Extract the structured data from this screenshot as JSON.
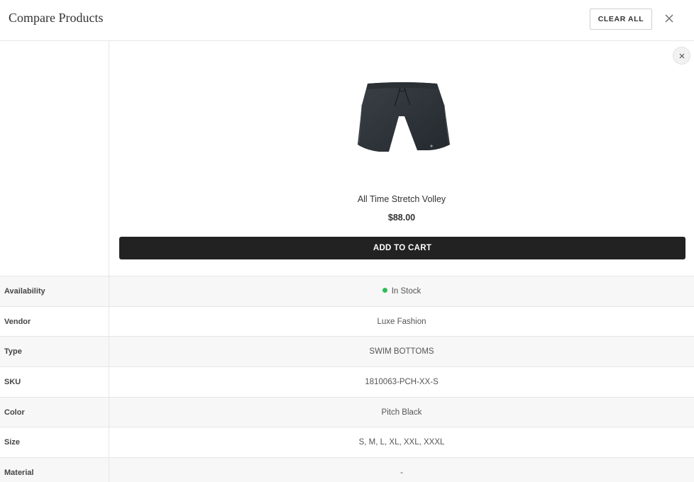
{
  "header": {
    "title": "Compare Products",
    "clear_all_label": "CLEAR ALL",
    "close_icon": "close-icon"
  },
  "product": {
    "name": "All Time Stretch Volley",
    "price": "$88.00",
    "add_to_cart_label": "ADD TO CART",
    "remove_icon": "close-icon",
    "image": "black-swim-shorts"
  },
  "attributes": [
    {
      "label": "Availability",
      "value": "In Stock",
      "status_color": "#2ebd59"
    },
    {
      "label": "Vendor",
      "value": "Luxe Fashion"
    },
    {
      "label": "Type",
      "value": "SWIM BOTTOMS"
    },
    {
      "label": "SKU",
      "value": "1810063-PCH-XX-S"
    },
    {
      "label": "Color",
      "value": "Pitch Black"
    },
    {
      "label": "Size",
      "value": "S, M, L, XL, XXL, XXXL"
    },
    {
      "label": "Material",
      "value": "-"
    }
  ],
  "colors": {
    "button_dark": "#222222",
    "in_stock": "#2ebd59",
    "row_alt": "#f7f7f7"
  }
}
